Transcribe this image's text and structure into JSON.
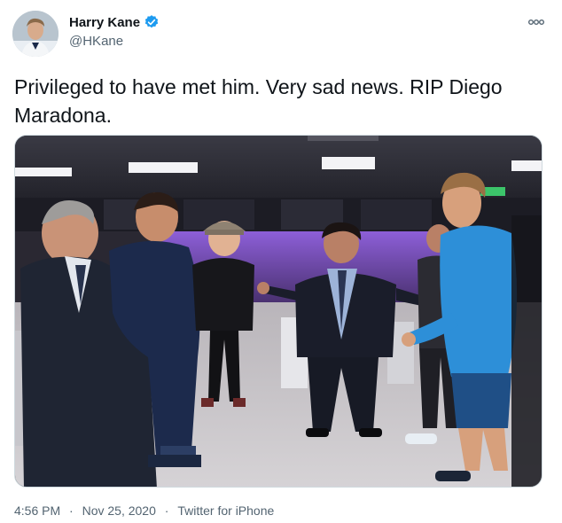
{
  "author": {
    "display_name": "Harry Kane",
    "handle": "@HKane",
    "verified": true,
    "avatar_icon": "user-avatar-icon",
    "verified_color": "#1d9bf0"
  },
  "tweet": {
    "text": "Privileged to have met him. Very sad news. RIP Diego Maradona.",
    "more_icon": "more-options-icon"
  },
  "photo": {
    "description_icon": "photo-locker-room-image"
  },
  "meta": {
    "time": "4:56 PM",
    "separator1": "·",
    "date": "Nov 25, 2020",
    "separator2": "·",
    "source": "Twitter for iPhone"
  }
}
